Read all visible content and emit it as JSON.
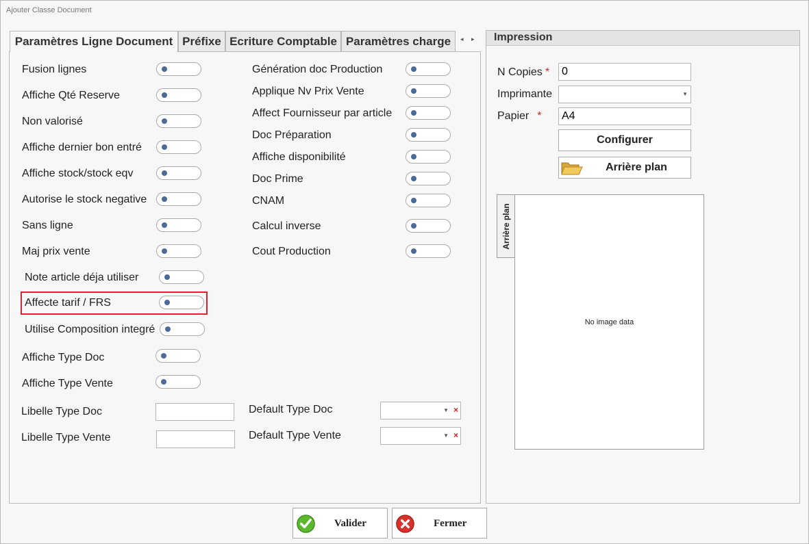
{
  "window": {
    "title": "Ajouter Classe Document"
  },
  "tabs": [
    {
      "label": "Paramètres Ligne Document"
    },
    {
      "label": "Préfixe"
    },
    {
      "label": "Ecriture Comptable"
    },
    {
      "label": "Paramètres charge"
    }
  ],
  "tab_scroll": {
    "left": "◂",
    "right": "▸"
  },
  "left_toggles": [
    {
      "label": "Fusion lignes"
    },
    {
      "label": "Affiche Qté Reserve"
    },
    {
      "label": "Non valorisé"
    },
    {
      "label": "Affiche dernier bon entré"
    },
    {
      "label": "Affiche stock/stock eqv"
    },
    {
      "label": "Autorise le stock negative"
    },
    {
      "label": "Sans ligne"
    },
    {
      "label": "Maj prix vente"
    },
    {
      "label": "Note article déja utiliser"
    },
    {
      "label": "Affecte tarif / FRS"
    },
    {
      "label": "Utilise Composition integré"
    },
    {
      "label": "Affiche Type Doc"
    },
    {
      "label": "Affiche Type Vente"
    }
  ],
  "right_toggles": [
    {
      "label": "Génération doc Production"
    },
    {
      "label": "Applique Nv Prix Vente"
    },
    {
      "label": "Affect Fournisseur par article"
    },
    {
      "label": "Doc Préparation"
    },
    {
      "label": "Affiche disponibilité"
    },
    {
      "label": "Doc Prime"
    },
    {
      "label": "CNAM"
    },
    {
      "label": "Calcul inverse"
    },
    {
      "label": "Cout Production"
    }
  ],
  "fields": {
    "libelle_type_doc": {
      "label": "Libelle Type Doc",
      "value": ""
    },
    "libelle_type_vente": {
      "label": "Libelle Type Vente",
      "value": ""
    },
    "default_type_doc": {
      "label": "Default Type Doc",
      "value": ""
    },
    "default_type_vente": {
      "label": "Default Type Vente",
      "value": ""
    }
  },
  "impression": {
    "header": "Impression",
    "n_copies": {
      "label": "N Copies",
      "required": "*",
      "value": "0"
    },
    "imprimante": {
      "label": "Imprimante",
      "value": ""
    },
    "papier": {
      "label": "Papier",
      "required": "*",
      "value": "A4"
    },
    "configurer_label": "Configurer",
    "arriere_plan_label": "Arrière plan",
    "vertical_tab_label": "Arrière plan",
    "no_image_text": "No image data"
  },
  "buttons": {
    "valider": "Valider",
    "fermer": "Fermer"
  },
  "colors": {
    "highlight": "#e0202a",
    "knob": "#4c6a99",
    "required": "#dd2222",
    "ok_green": "#5cb82e",
    "close_red": "#d9322c"
  }
}
